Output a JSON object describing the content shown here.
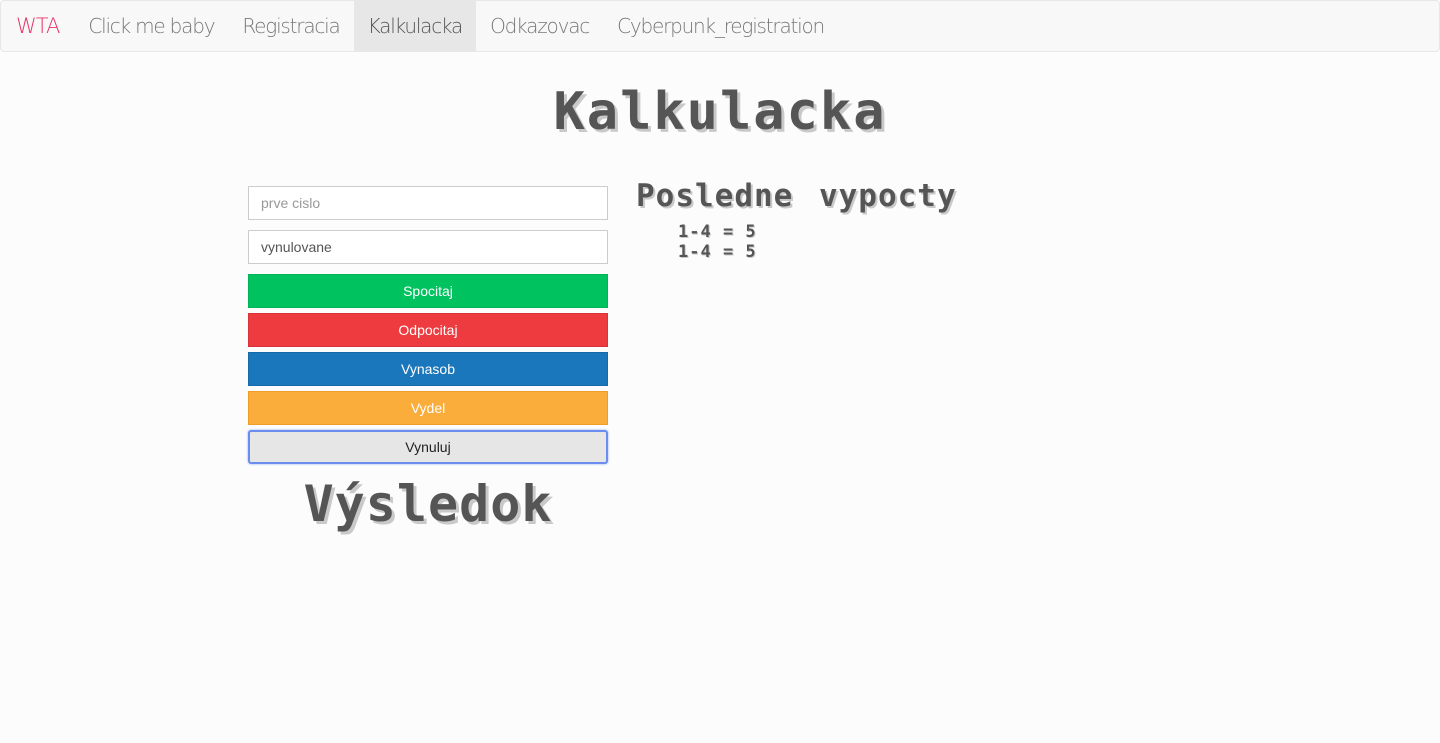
{
  "navbar": {
    "brand": "WTA",
    "items": [
      {
        "label": "Click me baby",
        "active": false
      },
      {
        "label": "Registracia",
        "active": false
      },
      {
        "label": "Kalkulacka",
        "active": true
      },
      {
        "label": "Odkazovac",
        "active": false
      },
      {
        "label": "Cyberpunk_registration",
        "active": false
      }
    ]
  },
  "page": {
    "title": "Kalkulacka"
  },
  "calculator": {
    "first_input_placeholder": "prve cislo",
    "first_input_value": "",
    "second_input_value": "vynulovane",
    "buttons": {
      "add": "Spocitaj",
      "subtract": "Odpocitaj",
      "multiply": "Vynasob",
      "divide": "Vydel",
      "reset": "Vynuluj"
    },
    "result_label": "Výsledok"
  },
  "history": {
    "title": "Posledne vypocty",
    "items": [
      "1-4 = 5",
      "1-4 = 5"
    ]
  },
  "colors": {
    "brand": "#e8336a",
    "add_button": "#00c25f",
    "subtract_button": "#ee3b40",
    "multiply_button": "#1b77bc",
    "divide_button": "#fbad3c",
    "reset_button": "#e6e6e6"
  }
}
